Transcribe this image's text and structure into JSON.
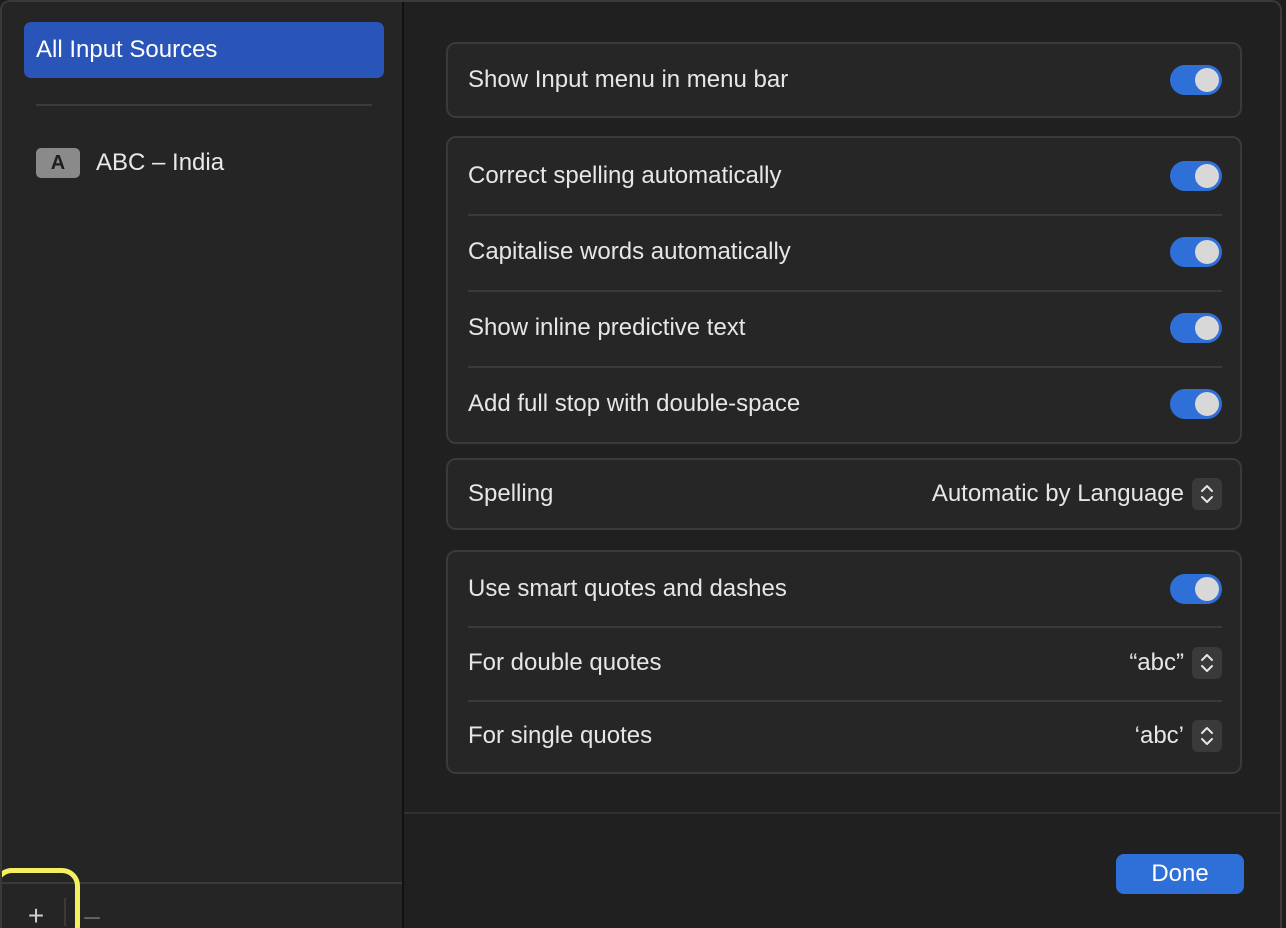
{
  "sidebar": {
    "selected_label": "All Input Sources",
    "items": [
      {
        "badge": "A",
        "label": "ABC – India"
      }
    ],
    "add_label": "+",
    "remove_label": "–"
  },
  "groups": {
    "menu": [
      {
        "label": "Show Input menu in menu bar",
        "on": true
      }
    ],
    "typing": [
      {
        "label": "Correct spelling automatically",
        "on": true
      },
      {
        "label": "Capitalise words automatically",
        "on": true
      },
      {
        "label": "Show inline predictive text",
        "on": true
      },
      {
        "label": "Add full stop with double-space",
        "on": true
      }
    ],
    "spelling": {
      "label": "Spelling",
      "value": "Automatic by Language"
    },
    "quotes": {
      "smart": {
        "label": "Use smart quotes and dashes",
        "on": true
      },
      "double": {
        "label": "For double quotes",
        "value": "“abc”"
      },
      "single": {
        "label": "For single quotes",
        "value": "‘abc’"
      }
    }
  },
  "footer": {
    "done_label": "Done"
  },
  "colors": {
    "accent": "#2f6fd8",
    "selection": "#2a55b8",
    "highlight": "#f4f060"
  }
}
